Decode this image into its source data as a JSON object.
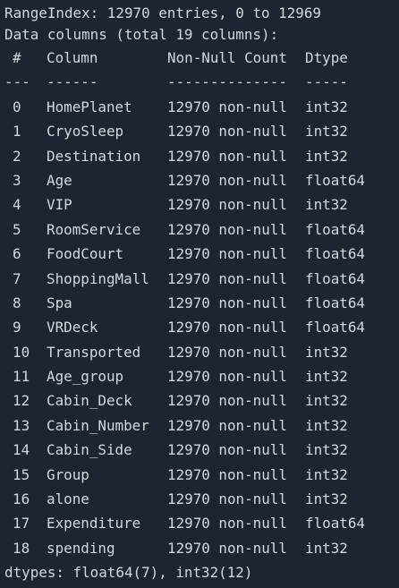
{
  "header": {
    "range_index": "RangeIndex: 12970 entries, 0 to 12969",
    "data_columns": "Data columns (total 19 columns):"
  },
  "table": {
    "headers": {
      "idx": "#",
      "column": "Column",
      "count": "Non-Null Count",
      "dtype": "Dtype"
    },
    "separators": {
      "idx": "---",
      "column": "------",
      "count": "--------------",
      "dtype": "-----"
    },
    "rows": [
      {
        "idx": "0",
        "column": "HomePlanet",
        "count": "12970 non-null",
        "dtype": "int32"
      },
      {
        "idx": "1",
        "column": "CryoSleep",
        "count": "12970 non-null",
        "dtype": "int32"
      },
      {
        "idx": "2",
        "column": "Destination",
        "count": "12970 non-null",
        "dtype": "int32"
      },
      {
        "idx": "3",
        "column": "Age",
        "count": "12970 non-null",
        "dtype": "float64"
      },
      {
        "idx": "4",
        "column": "VIP",
        "count": "12970 non-null",
        "dtype": "int32"
      },
      {
        "idx": "5",
        "column": "RoomService",
        "count": "12970 non-null",
        "dtype": "float64"
      },
      {
        "idx": "6",
        "column": "FoodCourt",
        "count": "12970 non-null",
        "dtype": "float64"
      },
      {
        "idx": "7",
        "column": "ShoppingMall",
        "count": "12970 non-null",
        "dtype": "float64"
      },
      {
        "idx": "8",
        "column": "Spa",
        "count": "12970 non-null",
        "dtype": "float64"
      },
      {
        "idx": "9",
        "column": "VRDeck",
        "count": "12970 non-null",
        "dtype": "float64"
      },
      {
        "idx": "10",
        "column": "Transported",
        "count": "12970 non-null",
        "dtype": "int32"
      },
      {
        "idx": "11",
        "column": "Age_group",
        "count": "12970 non-null",
        "dtype": "int32"
      },
      {
        "idx": "12",
        "column": "Cabin_Deck",
        "count": "12970 non-null",
        "dtype": "int32"
      },
      {
        "idx": "13",
        "column": "Cabin_Number",
        "count": "12970 non-null",
        "dtype": "int32"
      },
      {
        "idx": "14",
        "column": "Cabin_Side",
        "count": "12970 non-null",
        "dtype": "int32"
      },
      {
        "idx": "15",
        "column": "Group",
        "count": "12970 non-null",
        "dtype": "int32"
      },
      {
        "idx": "16",
        "column": "alone",
        "count": "12970 non-null",
        "dtype": "int32"
      },
      {
        "idx": "17",
        "column": "Expenditure",
        "count": "12970 non-null",
        "dtype": "float64"
      },
      {
        "idx": "18",
        "column": "spending",
        "count": "12970 non-null",
        "dtype": "int32"
      }
    ]
  },
  "footer": {
    "dtypes": "dtypes: float64(7), int32(12)"
  },
  "colors": {
    "background": "#1e2430",
    "text": "#d4d8de"
  }
}
